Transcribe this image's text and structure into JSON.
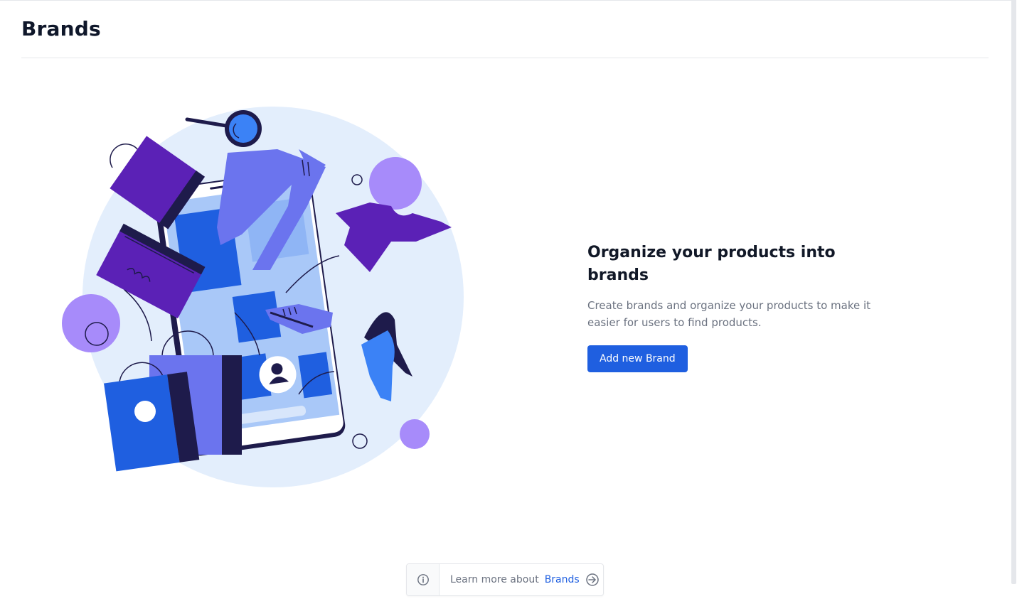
{
  "header": {
    "title": "Brands"
  },
  "empty_state": {
    "heading": "Organize your products into brands",
    "description": "Create brands and organize your products to make it easier for users to find products.",
    "cta_label": "Add new Brand"
  },
  "learn_more": {
    "text": "Learn more about",
    "link_label": "Brands",
    "info_icon": "info-icon",
    "arrow_icon": "arrow-right-circle-icon"
  },
  "colors": {
    "accent": "#1f5fe0",
    "title": "#0f172a",
    "muted": "#6b7280",
    "illustration_bg": "#e3eefc",
    "purple_dark": "#5b21b6",
    "purple_light": "#a78bfa",
    "periwinkle": "#6b74ee",
    "navy": "#1e1b4b"
  }
}
